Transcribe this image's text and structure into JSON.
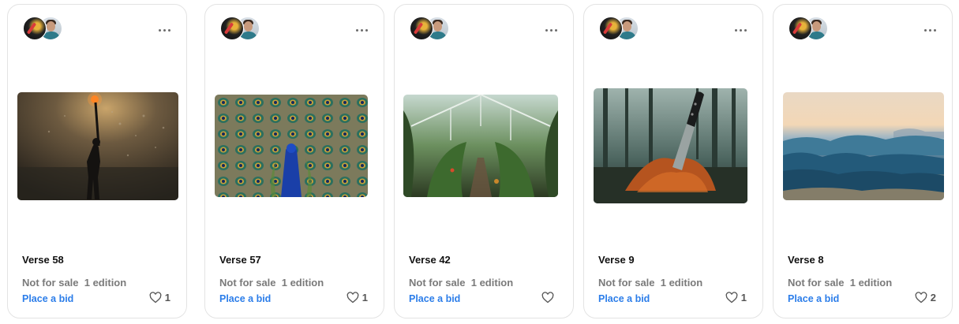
{
  "cards": [
    {
      "title": "Verse 58",
      "status": "Not for sale  1 edition",
      "bid": "Place a bid",
      "likes": "1",
      "image": "silhouette-person-dark-sky-photo"
    },
    {
      "title": "Verse 57",
      "status": "Not for sale  1 edition",
      "bid": "Place a bid",
      "likes": "1",
      "image": "peacock-feathers-photo"
    },
    {
      "title": "Verse 42",
      "status": "Not for sale  1 edition",
      "bid": "Place a bid",
      "likes": "",
      "image": "greenhouse-interior-photo"
    },
    {
      "title": "Verse 9",
      "status": "Not for sale  1 edition",
      "bid": "Place a bid",
      "likes": "1",
      "image": "knife-in-soil-forest-photo"
    },
    {
      "title": "Verse 8",
      "status": "Not for sale  1 edition",
      "bid": "Place a bid",
      "likes": "2",
      "image": "ocean-waves-sunset-photo"
    }
  ],
  "icons": {
    "more": "more-horizontal-icon",
    "like": "heart-outline-icon"
  },
  "colors": {
    "link": "#2b7de9",
    "muted": "#7a7a7a",
    "border": "#e3e3e3"
  }
}
